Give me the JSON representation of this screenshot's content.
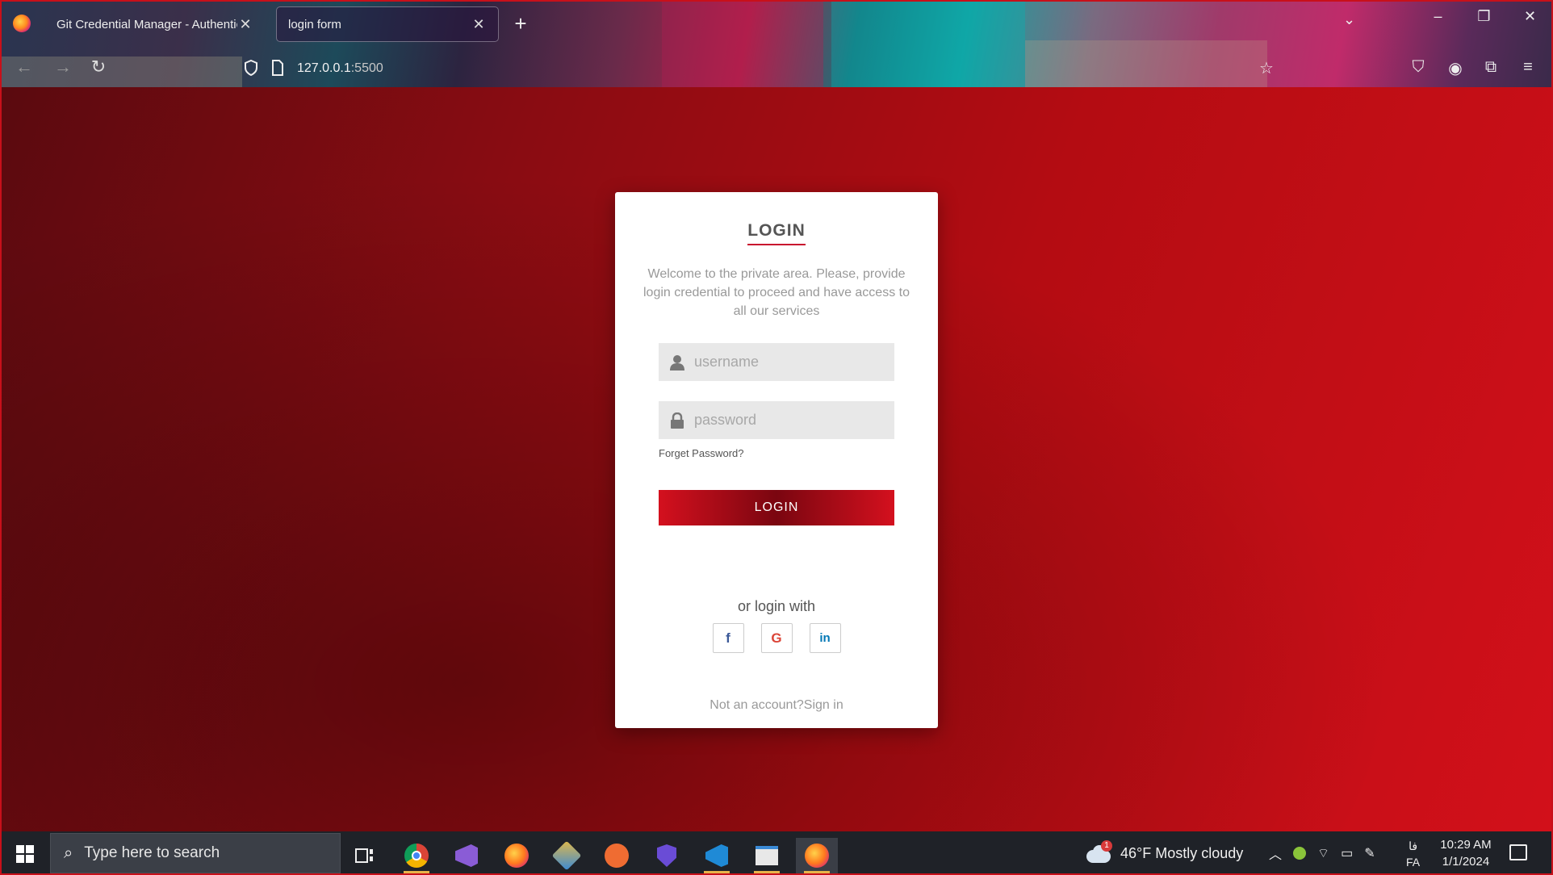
{
  "browser": {
    "tabs": [
      {
        "label": "Git Credential Manager - Authentic",
        "active": false
      },
      {
        "label": "login form",
        "active": true
      }
    ],
    "url_host": "127.0.0.1",
    "url_port": ":5500"
  },
  "login": {
    "title": "LOGIN",
    "description": "Welcome to the private area. Please, provide login credential to proceed and have access to all our services",
    "username_placeholder": "username",
    "password_placeholder": "password",
    "forgot_label": "Forget Password?",
    "button_label": "LOGIN",
    "or_label": "or login with",
    "socials": [
      "f",
      "G",
      "in"
    ],
    "signup_prefix": "Not an account?",
    "signup_link": "Sign in"
  },
  "taskbar": {
    "search_placeholder": "Type here to search",
    "weather": "46°F  Mostly cloudy",
    "weather_badge": "1",
    "lang_top": "فا",
    "lang_bottom": "FA",
    "time": "10:29 AM",
    "date": "1/1/2024"
  },
  "colors": {
    "accent": "#c8102e",
    "page_bg_dark": "#5a0a0f",
    "page_bg_light": "#d2101a"
  }
}
